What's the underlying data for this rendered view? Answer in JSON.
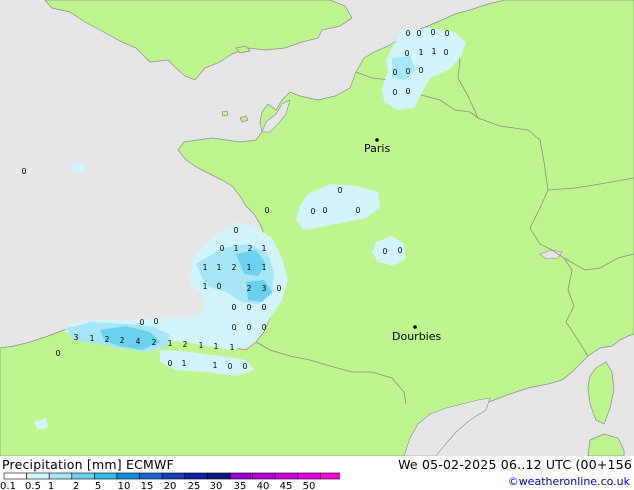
{
  "map": {
    "colors": {
      "sea": "#e6e6e6",
      "land": "#bff58f",
      "border": "#8a8a8a",
      "precip_light": "#d2f4fd",
      "precip_mid": "#a6e6f6",
      "precip_heavy": "#6cd1ef"
    },
    "cities": [
      {
        "label": "Paris"
      },
      {
        "label": "Dourbies"
      }
    ],
    "precip_values": [
      {
        "v": "0"
      },
      {
        "v": "0"
      },
      {
        "v": "0"
      },
      {
        "v": "0"
      },
      {
        "v": "0"
      },
      {
        "v": "1"
      },
      {
        "v": "1"
      },
      {
        "v": "0"
      },
      {
        "v": "0"
      },
      {
        "v": "0"
      },
      {
        "v": "0"
      },
      {
        "v": "0"
      },
      {
        "v": "0"
      },
      {
        "v": "0"
      },
      {
        "v": "0"
      },
      {
        "v": "0"
      },
      {
        "v": "0"
      },
      {
        "v": "0"
      },
      {
        "v": "0"
      },
      {
        "v": "0"
      },
      {
        "v": "0"
      },
      {
        "v": "0"
      },
      {
        "v": "0"
      },
      {
        "v": "1"
      },
      {
        "v": "2"
      },
      {
        "v": "1"
      },
      {
        "v": "1"
      },
      {
        "v": "1"
      },
      {
        "v": "2"
      },
      {
        "v": "1"
      },
      {
        "v": "1"
      },
      {
        "v": "1"
      },
      {
        "v": "0"
      },
      {
        "v": "2"
      },
      {
        "v": "3"
      },
      {
        "v": "0"
      },
      {
        "v": "0"
      },
      {
        "v": "0"
      },
      {
        "v": "0"
      },
      {
        "v": "0"
      },
      {
        "v": "0"
      },
      {
        "v": "0"
      },
      {
        "v": "0"
      },
      {
        "v": "0"
      },
      {
        "v": "3"
      },
      {
        "v": "1"
      },
      {
        "v": "2"
      },
      {
        "v": "2"
      },
      {
        "v": "4"
      },
      {
        "v": "2"
      },
      {
        "v": "1"
      },
      {
        "v": "2"
      },
      {
        "v": "1"
      },
      {
        "v": "1"
      },
      {
        "v": "1"
      },
      {
        "v": "0"
      },
      {
        "v": "0"
      },
      {
        "v": "1"
      },
      {
        "v": "1"
      },
      {
        "v": "0"
      },
      {
        "v": "0"
      }
    ]
  },
  "footer": {
    "title_left": "Precipitation [mm] ECMWF",
    "title_right": "We 05-02-2025 06..12 UTC (00+156",
    "credit": "©weatheronline.co.uk",
    "legend": {
      "colors": [
        "#ffffff",
        "#d2f4fd",
        "#a6e6f6",
        "#6cd1ef",
        "#2dbde8",
        "#0f8fe0",
        "#1f63d2",
        "#1a3eb4",
        "#10219b",
        "#091a83",
        "#9a00ce",
        "#b700da",
        "#d100e0",
        "#ea00e6",
        "#fa0ad7"
      ],
      "ticks": [
        "0.1",
        "0.5",
        "1",
        "2",
        "5",
        "10",
        "15",
        "20",
        "25",
        "30",
        "35",
        "40",
        "45",
        "50"
      ]
    }
  }
}
